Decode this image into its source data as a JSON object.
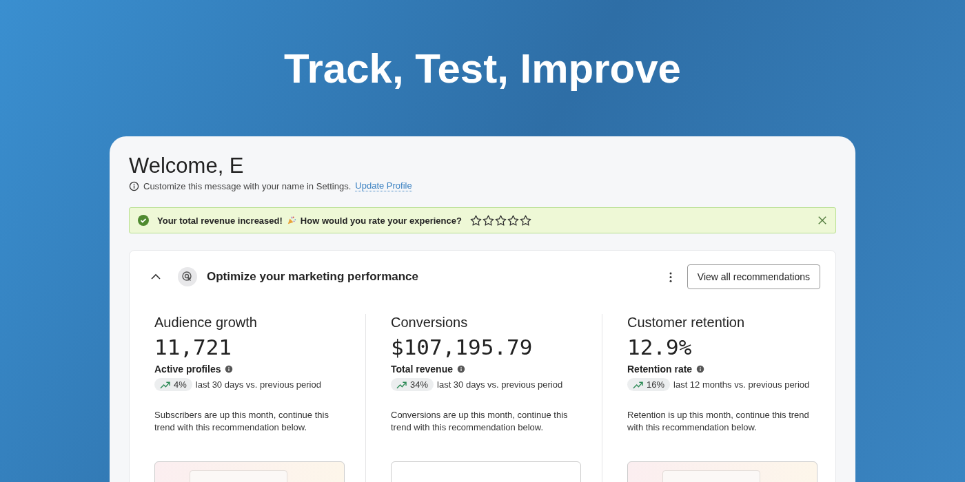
{
  "headline": "Track, Test, Improve",
  "welcome": {
    "title": "Welcome, E",
    "hint": "Customize this message with your name in Settings.",
    "link": "Update Profile"
  },
  "banner": {
    "message": "Your total revenue increased!",
    "question": "How would you rate your experience?",
    "stars": 0
  },
  "card": {
    "title": "Optimize your marketing performance",
    "expanded": true,
    "button": "View all recommendations",
    "metrics": [
      {
        "title": "Audience growth",
        "value": "11,721",
        "label": "Active profiles",
        "change": "4%",
        "period": "last 30 days vs. previous period",
        "note": "Subscribers are up this month, continue this trend with this recommendation below.",
        "kind": "tinted"
      },
      {
        "title": "Conversions",
        "value": "$107,195.79",
        "label": "Total revenue",
        "change": "34%",
        "period": "last 30 days vs. previous period",
        "note": "Conversions are up this month, continue this trend with this recommendation below.",
        "kind": "plain"
      },
      {
        "title": "Customer retention",
        "value": "12.9%",
        "label": "Retention rate",
        "change": "16%",
        "period": "last 12 months vs. previous period",
        "note": "Retention is up this month, continue this trend with this recommendation below.",
        "kind": "tinted"
      }
    ]
  }
}
